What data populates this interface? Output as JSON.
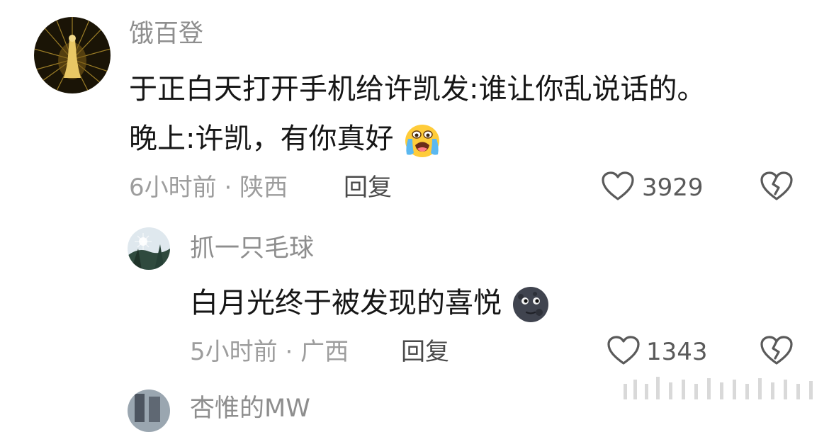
{
  "comments": [
    {
      "username": "饿百登",
      "lines": [
        "于正白天打开手机给许凯发:谁让你乱说话的。",
        "晚上:许凯，有你真好"
      ],
      "emoji": "loudly-crying-face-emoji",
      "time": "6小时前",
      "separator": "·",
      "region": "陕西",
      "reply_label": "回复",
      "likes": "3929"
    },
    {
      "username": "抓一只毛球",
      "lines": [
        "白月光终于被发现的喜悦"
      ],
      "emoji": "new-moon-face-emoji",
      "time": "5小时前",
      "separator": "·",
      "region": "广西",
      "reply_label": "回复",
      "likes": "1343"
    },
    {
      "username": "杏惟的MW"
    }
  ],
  "icons": {
    "like": "heart-outline-icon",
    "dislike": "broken-heart-outline-icon"
  },
  "colors": {
    "username": "#8e8e8e",
    "content": "#161616",
    "meta": "#9d9d9d"
  }
}
